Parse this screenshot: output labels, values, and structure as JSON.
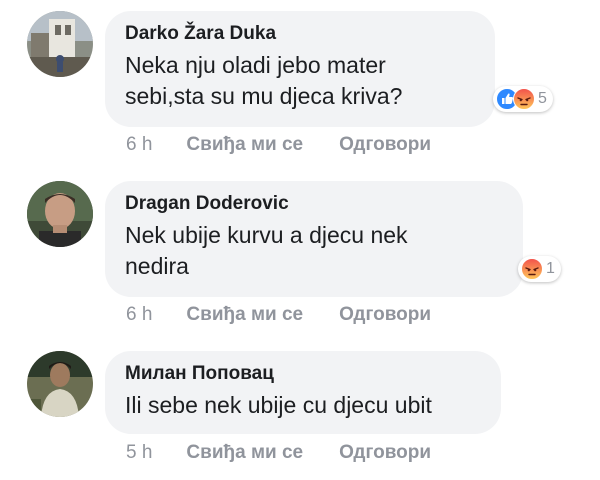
{
  "comments": [
    {
      "author": "Darko Žara Duka",
      "text": "Neka nju oladi jebo mater\nsebi,sta su mu djeca kriva?",
      "time": "6 h",
      "like_label": "Свиђа ми се",
      "reply_label": "Одговори",
      "reaction_count": "5",
      "reaction_icons": [
        "like-icon",
        "angry-icon"
      ]
    },
    {
      "author": "Dragan Doderovic",
      "text": "Nek ubije kurvu a djecu nek\nnedira",
      "time": "6 h",
      "like_label": "Свиђа ми се",
      "reply_label": "Одговори",
      "reaction_count": "1",
      "reaction_icons": [
        "angry-icon"
      ]
    },
    {
      "author": "Милан Поповац",
      "text": "Ili sebe nek ubije cu djecu ubit",
      "time": "5 h",
      "like_label": "Свиђа ми се",
      "reply_label": "Одговори"
    }
  ],
  "colors": {
    "bubble": "#f2f3f5",
    "meta_text": "#90949c",
    "like_blue": "#2e89ff",
    "angry_orange": "#f7714c"
  }
}
